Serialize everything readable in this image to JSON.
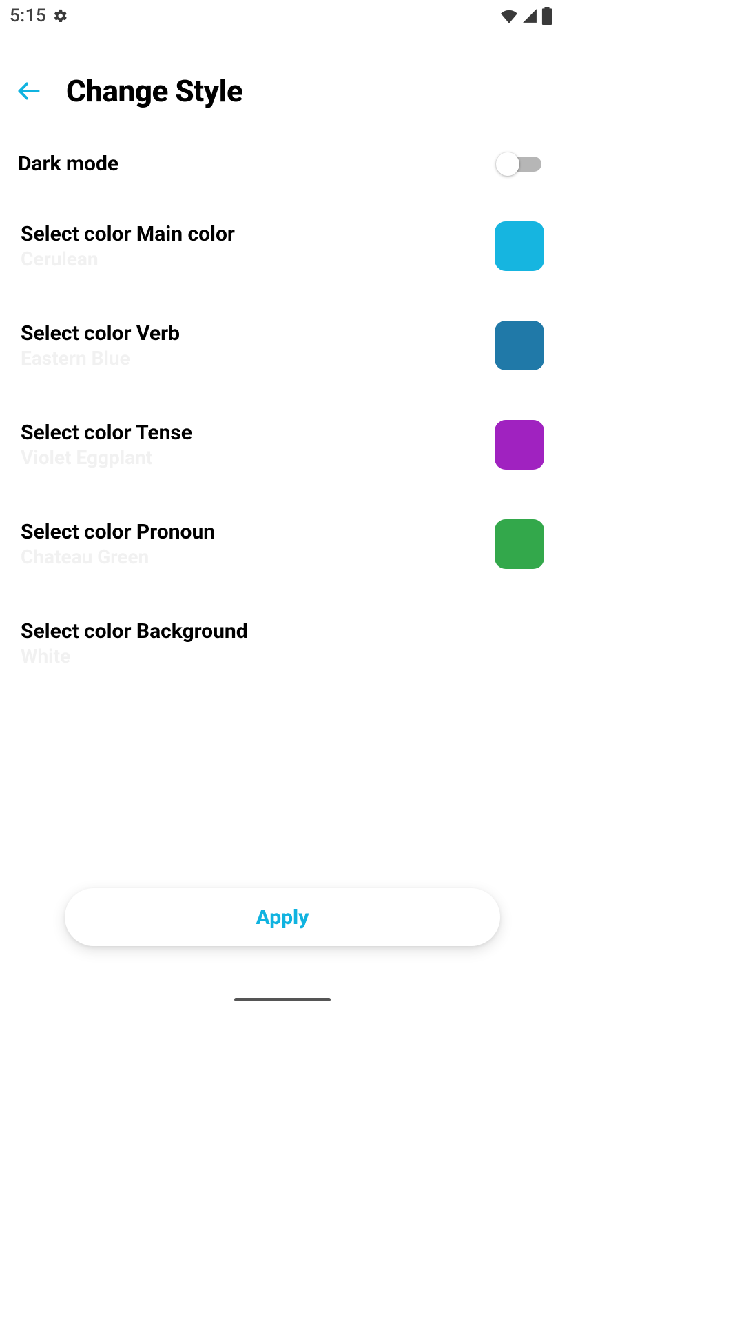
{
  "status_bar": {
    "time": "5:15"
  },
  "header": {
    "title": "Change Style"
  },
  "dark_mode": {
    "label": "Dark mode",
    "on": false
  },
  "color_rows": [
    {
      "title": "Select color Main color",
      "value_name": "Cerulean",
      "swatch": "#16b5e0"
    },
    {
      "title": "Select color Verb",
      "value_name": "Eastern Blue",
      "swatch": "#2079a8"
    },
    {
      "title": "Select color Tense",
      "value_name": "Violet Eggplant",
      "swatch": "#a022c0"
    },
    {
      "title": "Select color Pronoun",
      "value_name": "Chateau Green",
      "swatch": "#33a84b"
    },
    {
      "title": "Select color Background",
      "value_name": "White",
      "swatch": "#ffffff"
    }
  ],
  "apply_button": {
    "label": "Apply"
  },
  "accent_color": "#10b3e0"
}
